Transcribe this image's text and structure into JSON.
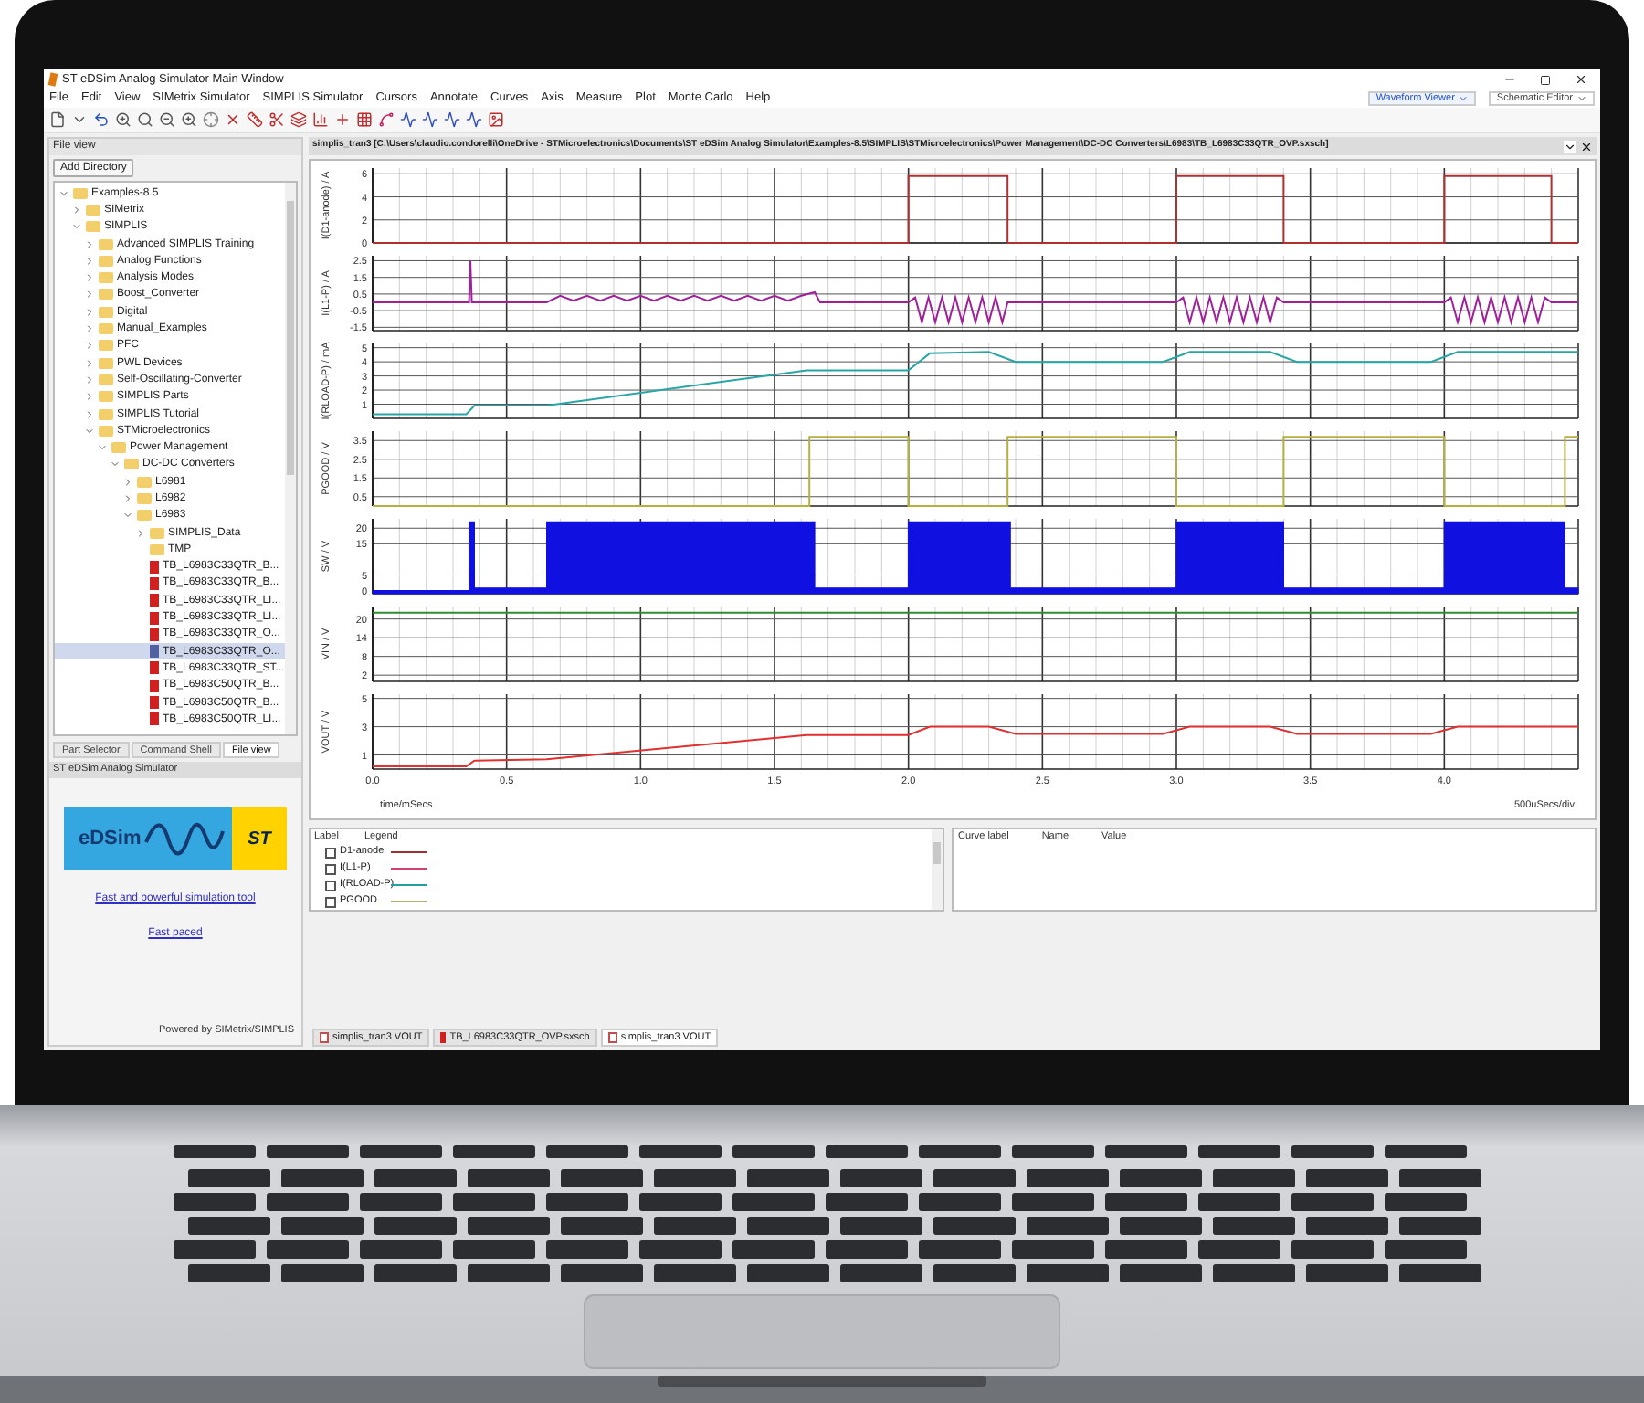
{
  "window": {
    "title": "ST eDSim Analog Simulator Main Window"
  },
  "menu": [
    "File",
    "Edit",
    "View",
    "SIMetrix Simulator",
    "SIMPLIS Simulator",
    "Cursors",
    "Annotate",
    "Curves",
    "Axis",
    "Measure",
    "Plot",
    "Monte Carlo",
    "Help"
  ],
  "view_switch": [
    {
      "label": "Waveform Viewer",
      "selected": true
    },
    {
      "label": "Schematic Editor",
      "selected": false
    }
  ],
  "file_view": {
    "header": "File view",
    "add_button": "Add Directory",
    "tree": [
      {
        "label": "Examples-8.5",
        "kind": "folder",
        "expanded": true,
        "selected": false,
        "children": [
          {
            "label": "SIMetrix",
            "kind": "folder",
            "expanded": false,
            "selected": false
          },
          {
            "label": "SIMPLIS",
            "kind": "folder",
            "expanded": true,
            "selected": false,
            "children": [
              {
                "label": "Advanced SIMPLIS Training",
                "kind": "folder",
                "expanded": false,
                "selected": false
              },
              {
                "label": "Analog Functions",
                "kind": "folder",
                "expanded": false,
                "selected": false
              },
              {
                "label": "Analysis Modes",
                "kind": "folder",
                "expanded": false,
                "selected": false
              },
              {
                "label": "Boost_Converter",
                "kind": "folder",
                "expanded": false,
                "selected": false
              },
              {
                "label": "Digital",
                "kind": "folder",
                "expanded": false,
                "selected": false
              },
              {
                "label": "Manual_Examples",
                "kind": "folder",
                "expanded": false,
                "selected": false
              },
              {
                "label": "PFC",
                "kind": "folder",
                "expanded": false,
                "selected": false
              },
              {
                "label": "PWL Devices",
                "kind": "folder",
                "expanded": false,
                "selected": false
              },
              {
                "label": "Self-Oscillating-Converter",
                "kind": "folder",
                "expanded": false,
                "selected": false
              },
              {
                "label": "SIMPLIS Parts",
                "kind": "folder",
                "expanded": false,
                "selected": false
              },
              {
                "label": "SIMPLIS Tutorial",
                "kind": "folder",
                "expanded": false,
                "selected": false
              },
              {
                "label": "STMicroelectronics",
                "kind": "folder",
                "expanded": true,
                "selected": false,
                "children": [
                  {
                    "label": "Power Management",
                    "kind": "folder",
                    "expanded": true,
                    "selected": false,
                    "children": [
                      {
                        "label": "DC-DC Converters",
                        "kind": "folder",
                        "expanded": true,
                        "selected": false,
                        "children": [
                          {
                            "label": "L6981",
                            "kind": "folder",
                            "expanded": false,
                            "selected": false
                          },
                          {
                            "label": "L6982",
                            "kind": "folder",
                            "expanded": false,
                            "selected": false
                          },
                          {
                            "label": "L6983",
                            "kind": "folder",
                            "expanded": true,
                            "selected": false,
                            "children": [
                              {
                                "label": "SIMPLIS_Data",
                                "kind": "folder",
                                "expanded": false,
                                "selected": false
                              },
                              {
                                "label": "TMP",
                                "kind": "empty-folder",
                                "selected": false
                              },
                              {
                                "label": "TB_L6983C33QTR_B...",
                                "kind": "file",
                                "selected": false
                              },
                              {
                                "label": "TB_L6983C33QTR_B...",
                                "kind": "file",
                                "selected": false
                              },
                              {
                                "label": "TB_L6983C33QTR_LI...",
                                "kind": "file",
                                "selected": false
                              },
                              {
                                "label": "TB_L6983C33QTR_LI...",
                                "kind": "file",
                                "selected": false
                              },
                              {
                                "label": "TB_L6983C33QTR_O...",
                                "kind": "file",
                                "selected": false
                              },
                              {
                                "label": "TB_L6983C33QTR_O...",
                                "kind": "file",
                                "selected": true
                              },
                              {
                                "label": "TB_L6983C33QTR_ST...",
                                "kind": "file",
                                "selected": false
                              },
                              {
                                "label": "TB_L6983C50QTR_B...",
                                "kind": "file",
                                "selected": false
                              },
                              {
                                "label": "TB_L6983C50QTR_B...",
                                "kind": "file",
                                "selected": false
                              },
                              {
                                "label": "TB_L6983C50QTR_LI...",
                                "kind": "file",
                                "selected": false
                              }
                            ]
                          }
                        ]
                      }
                    ]
                  }
                ]
              }
            ]
          }
        ]
      }
    ]
  },
  "pane_tabs": [
    {
      "label": "Part Selector",
      "selected": false
    },
    {
      "label": "Command Shell",
      "selected": false
    },
    {
      "label": "File view",
      "selected": true
    }
  ],
  "about": {
    "header": "ST eDSim Analog Simulator",
    "logo_text": "eDSim",
    "brand_text": "ST",
    "link": "Fast and powerful simulation tool",
    "link_2": "Fast paced",
    "footer": "Powered by SIMetrix/SIMPLIS"
  },
  "document": {
    "title": "simplis_tran3 [C:\\Users\\claudio.condorelli\\OneDrive - STMicroelectronics\\Documents\\ST eDSim Analog Simulator\\Examples-8.5\\SIMPLIS\\STMicroelectronics\\Power Management\\DC-DC Converters\\L6983\\TB_L6983C33QTR_OVP.sxsch]"
  },
  "plot": {
    "scale_label": "500uSecs/div",
    "panels": [
      {
        "chart_data": {
          "type": "line",
          "grid": true,
          "ylabel": "I(D1-anode) / A",
          "xlim": [
            0,
            4.5
          ],
          "ylim": [
            0,
            6.5
          ],
          "yticks": [
            0,
            2,
            4,
            6
          ],
          "x": [
            0,
            2.0,
            2.0,
            2.37,
            2.37,
            3.0,
            3.0,
            3.4,
            3.4,
            4.0,
            4.0,
            4.4,
            4.4,
            4.5
          ],
          "series": [
            {
              "color": "#b03030",
              "values": [
                0,
                0,
                5.8,
                5.8,
                0,
                0,
                5.8,
                5.8,
                0,
                0,
                5.8,
                5.8,
                0,
                0
              ]
            }
          ]
        }
      },
      {
        "chart_data": {
          "type": "line",
          "grid": true,
          "ylabel": "I(L1-P) / A",
          "xlim": [
            0,
            4.5
          ],
          "ylim": [
            -1.7,
            2.8
          ],
          "yticks": [
            -1.5,
            -0.5,
            0.5,
            1.5,
            2.5
          ],
          "x": [
            0,
            0.36,
            0.365,
            0.37,
            0.65,
            0.7,
            0.75,
            0.8,
            0.85,
            0.9,
            0.95,
            1.0,
            1.05,
            1.1,
            1.15,
            1.2,
            1.25,
            1.3,
            1.35,
            1.4,
            1.45,
            1.5,
            1.55,
            1.6,
            1.65,
            1.67,
            2.0,
            2.025,
            2.05,
            2.075,
            2.1,
            2.125,
            2.15,
            2.175,
            2.2,
            2.225,
            2.25,
            2.275,
            2.3,
            2.325,
            2.35,
            2.37,
            3.0,
            3.025,
            3.05,
            3.075,
            3.1,
            3.125,
            3.15,
            3.175,
            3.2,
            3.225,
            3.25,
            3.275,
            3.3,
            3.325,
            3.35,
            3.375,
            3.4,
            4.0,
            4.025,
            4.05,
            4.075,
            4.1,
            4.125,
            4.15,
            4.175,
            4.2,
            4.225,
            4.25,
            4.275,
            4.3,
            4.325,
            4.35,
            4.375,
            4.4,
            4.5
          ],
          "series": [
            {
              "color": "#a0209a",
              "values": [
                0,
                0,
                2.5,
                0,
                0,
                0.4,
                0.1,
                0.4,
                0.1,
                0.4,
                0.1,
                0.4,
                0.1,
                0.4,
                0.1,
                0.4,
                0.1,
                0.4,
                0.1,
                0.4,
                0.1,
                0.4,
                0.1,
                0.4,
                0.6,
                0,
                0,
                0.3,
                -1.2,
                0.3,
                -1.2,
                0.3,
                -1.2,
                0.3,
                -1.2,
                0.3,
                -1.2,
                0.3,
                -1.2,
                0.3,
                -1.2,
                0,
                0,
                0.3,
                -1.2,
                0.3,
                -1.2,
                0.3,
                -1.2,
                0.3,
                -1.2,
                0.3,
                -1.2,
                0.3,
                -1.2,
                0.3,
                -1.2,
                0.3,
                0,
                0,
                0.3,
                -1.2,
                0.3,
                -1.2,
                0.3,
                -1.2,
                0.3,
                -1.2,
                0.3,
                -1.2,
                0.3,
                -1.2,
                0.3,
                -1.2,
                0.3,
                0,
                0
              ]
            }
          ]
        }
      },
      {
        "chart_data": {
          "type": "line",
          "grid": true,
          "ylabel": "I(RLOAD-P) / mA",
          "xlim": [
            0,
            4.5
          ],
          "ylim": [
            0,
            5.3
          ],
          "yticks": [
            1,
            2,
            3,
            4,
            5
          ],
          "x": [
            0,
            0.35,
            0.38,
            0.65,
            1.62,
            2.0,
            2.08,
            2.3,
            2.4,
            2.95,
            3.05,
            3.35,
            3.45,
            3.95,
            4.05,
            4.5
          ],
          "series": [
            {
              "color": "#2aa5a5",
              "values": [
                0.3,
                0.3,
                0.9,
                0.9,
                3.4,
                3.4,
                4.6,
                4.7,
                4.0,
                4.0,
                4.7,
                4.7,
                4.0,
                4.0,
                4.7,
                4.7
              ]
            }
          ]
        }
      },
      {
        "chart_data": {
          "type": "line",
          "grid": true,
          "ylabel": "PGOOD / V",
          "xlim": [
            0,
            4.5
          ],
          "ylim": [
            0,
            4
          ],
          "yticks": [
            0.5,
            1.5,
            2.5,
            3.5
          ],
          "x": [
            0,
            1.63,
            1.63,
            2.0,
            2.0,
            2.37,
            2.37,
            3.0,
            3.0,
            3.4,
            3.4,
            4.0,
            4.0,
            4.45,
            4.45,
            4.5
          ],
          "series": [
            {
              "color": "#b5b040",
              "values": [
                0,
                0,
                3.7,
                3.7,
                0,
                0,
                3.7,
                3.7,
                0,
                0,
                3.7,
                3.7,
                0,
                0,
                3.7,
                3.7
              ]
            }
          ]
        }
      },
      {
        "chart_data": {
          "type": "area",
          "grid": true,
          "ylabel": "SW / V",
          "xlim": [
            0,
            4.5
          ],
          "ylim": [
            -1,
            23
          ],
          "yticks": [
            0,
            5,
            15,
            20
          ],
          "x": [
            0,
            0.36,
            0.36,
            0.38,
            0.38,
            0.65,
            0.65,
            1.65,
            1.65,
            2.0,
            2.0,
            2.38,
            2.38,
            3.0,
            3.0,
            3.4,
            3.4,
            4.0,
            4.0,
            4.45,
            4.45,
            4.5
          ],
          "series": [
            {
              "color": "#1010e0",
              "values": [
                0,
                0,
                22,
                22,
                0.8,
                0.8,
                22,
                22,
                0.8,
                0.8,
                22,
                22,
                0.8,
                0.8,
                22,
                22,
                0.8,
                0.8,
                22,
                22,
                0.8,
                0.8
              ]
            }
          ]
        }
      },
      {
        "chart_data": {
          "type": "line",
          "grid": true,
          "ylabel": "VIN / V",
          "xlim": [
            0,
            4.5
          ],
          "ylim": [
            0,
            24
          ],
          "yticks": [
            2,
            8,
            14,
            20
          ],
          "x": [
            0,
            4.5
          ],
          "series": [
            {
              "color": "#2f8f2f",
              "values": [
                22,
                22
              ]
            }
          ]
        }
      },
      {
        "chart_data": {
          "type": "line",
          "grid": true,
          "ylabel": "VOUT / V",
          "xlabel": "time/mSecs",
          "xlim": [
            0,
            4.5
          ],
          "ylim": [
            0,
            5.3
          ],
          "yticks": [
            1,
            3,
            5
          ],
          "xticks": [
            {
              "value": 0,
              "label": "0.0"
            },
            {
              "value": 0.5,
              "label": "0.5"
            },
            {
              "value": 1,
              "label": "1.0"
            },
            {
              "value": 1.5,
              "label": "1.5"
            },
            {
              "value": 2,
              "label": "2.0"
            },
            {
              "value": 2.5,
              "label": "2.5"
            },
            {
              "value": 3,
              "label": "3.0"
            },
            {
              "value": 3.5,
              "label": "3.5"
            },
            {
              "value": 4,
              "label": "4.0"
            }
          ],
          "x": [
            0,
            0.35,
            0.38,
            0.65,
            1.62,
            2.0,
            2.08,
            2.3,
            2.4,
            2.95,
            3.05,
            3.35,
            3.45,
            3.95,
            4.05,
            4.5
          ],
          "series": [
            {
              "color": "#e03030",
              "values": [
                0.2,
                0.2,
                0.6,
                0.7,
                2.4,
                2.4,
                3.0,
                3.0,
                2.5,
                2.5,
                3.0,
                3.0,
                2.5,
                2.5,
                3.0,
                3.0
              ]
            }
          ]
        }
      }
    ]
  },
  "legend": {
    "columns": [
      "Label",
      "Legend"
    ],
    "rows": [
      {
        "label": "D1-anode",
        "color": "#a03030",
        "checked": false
      },
      {
        "label": "I(L1-P)",
        "color": "#d04070",
        "checked": false
      },
      {
        "label": "I(RLOAD-P)",
        "color": "#20a0a0",
        "checked": false
      },
      {
        "label": "PGOOD",
        "color": "#b5b070",
        "checked": false
      }
    ]
  },
  "cursor_table": {
    "columns": [
      "Curve label",
      "Name",
      "Value"
    ]
  },
  "doc_tabs": [
    {
      "label": "simplis_tran3 VOUT",
      "kind": "graph",
      "selected": false
    },
    {
      "label": "TB_L6983C33QTR_OVP.sxsch",
      "kind": "schematic",
      "selected": false
    },
    {
      "label": "simplis_tran3 VOUT",
      "kind": "graph",
      "selected": true
    }
  ]
}
